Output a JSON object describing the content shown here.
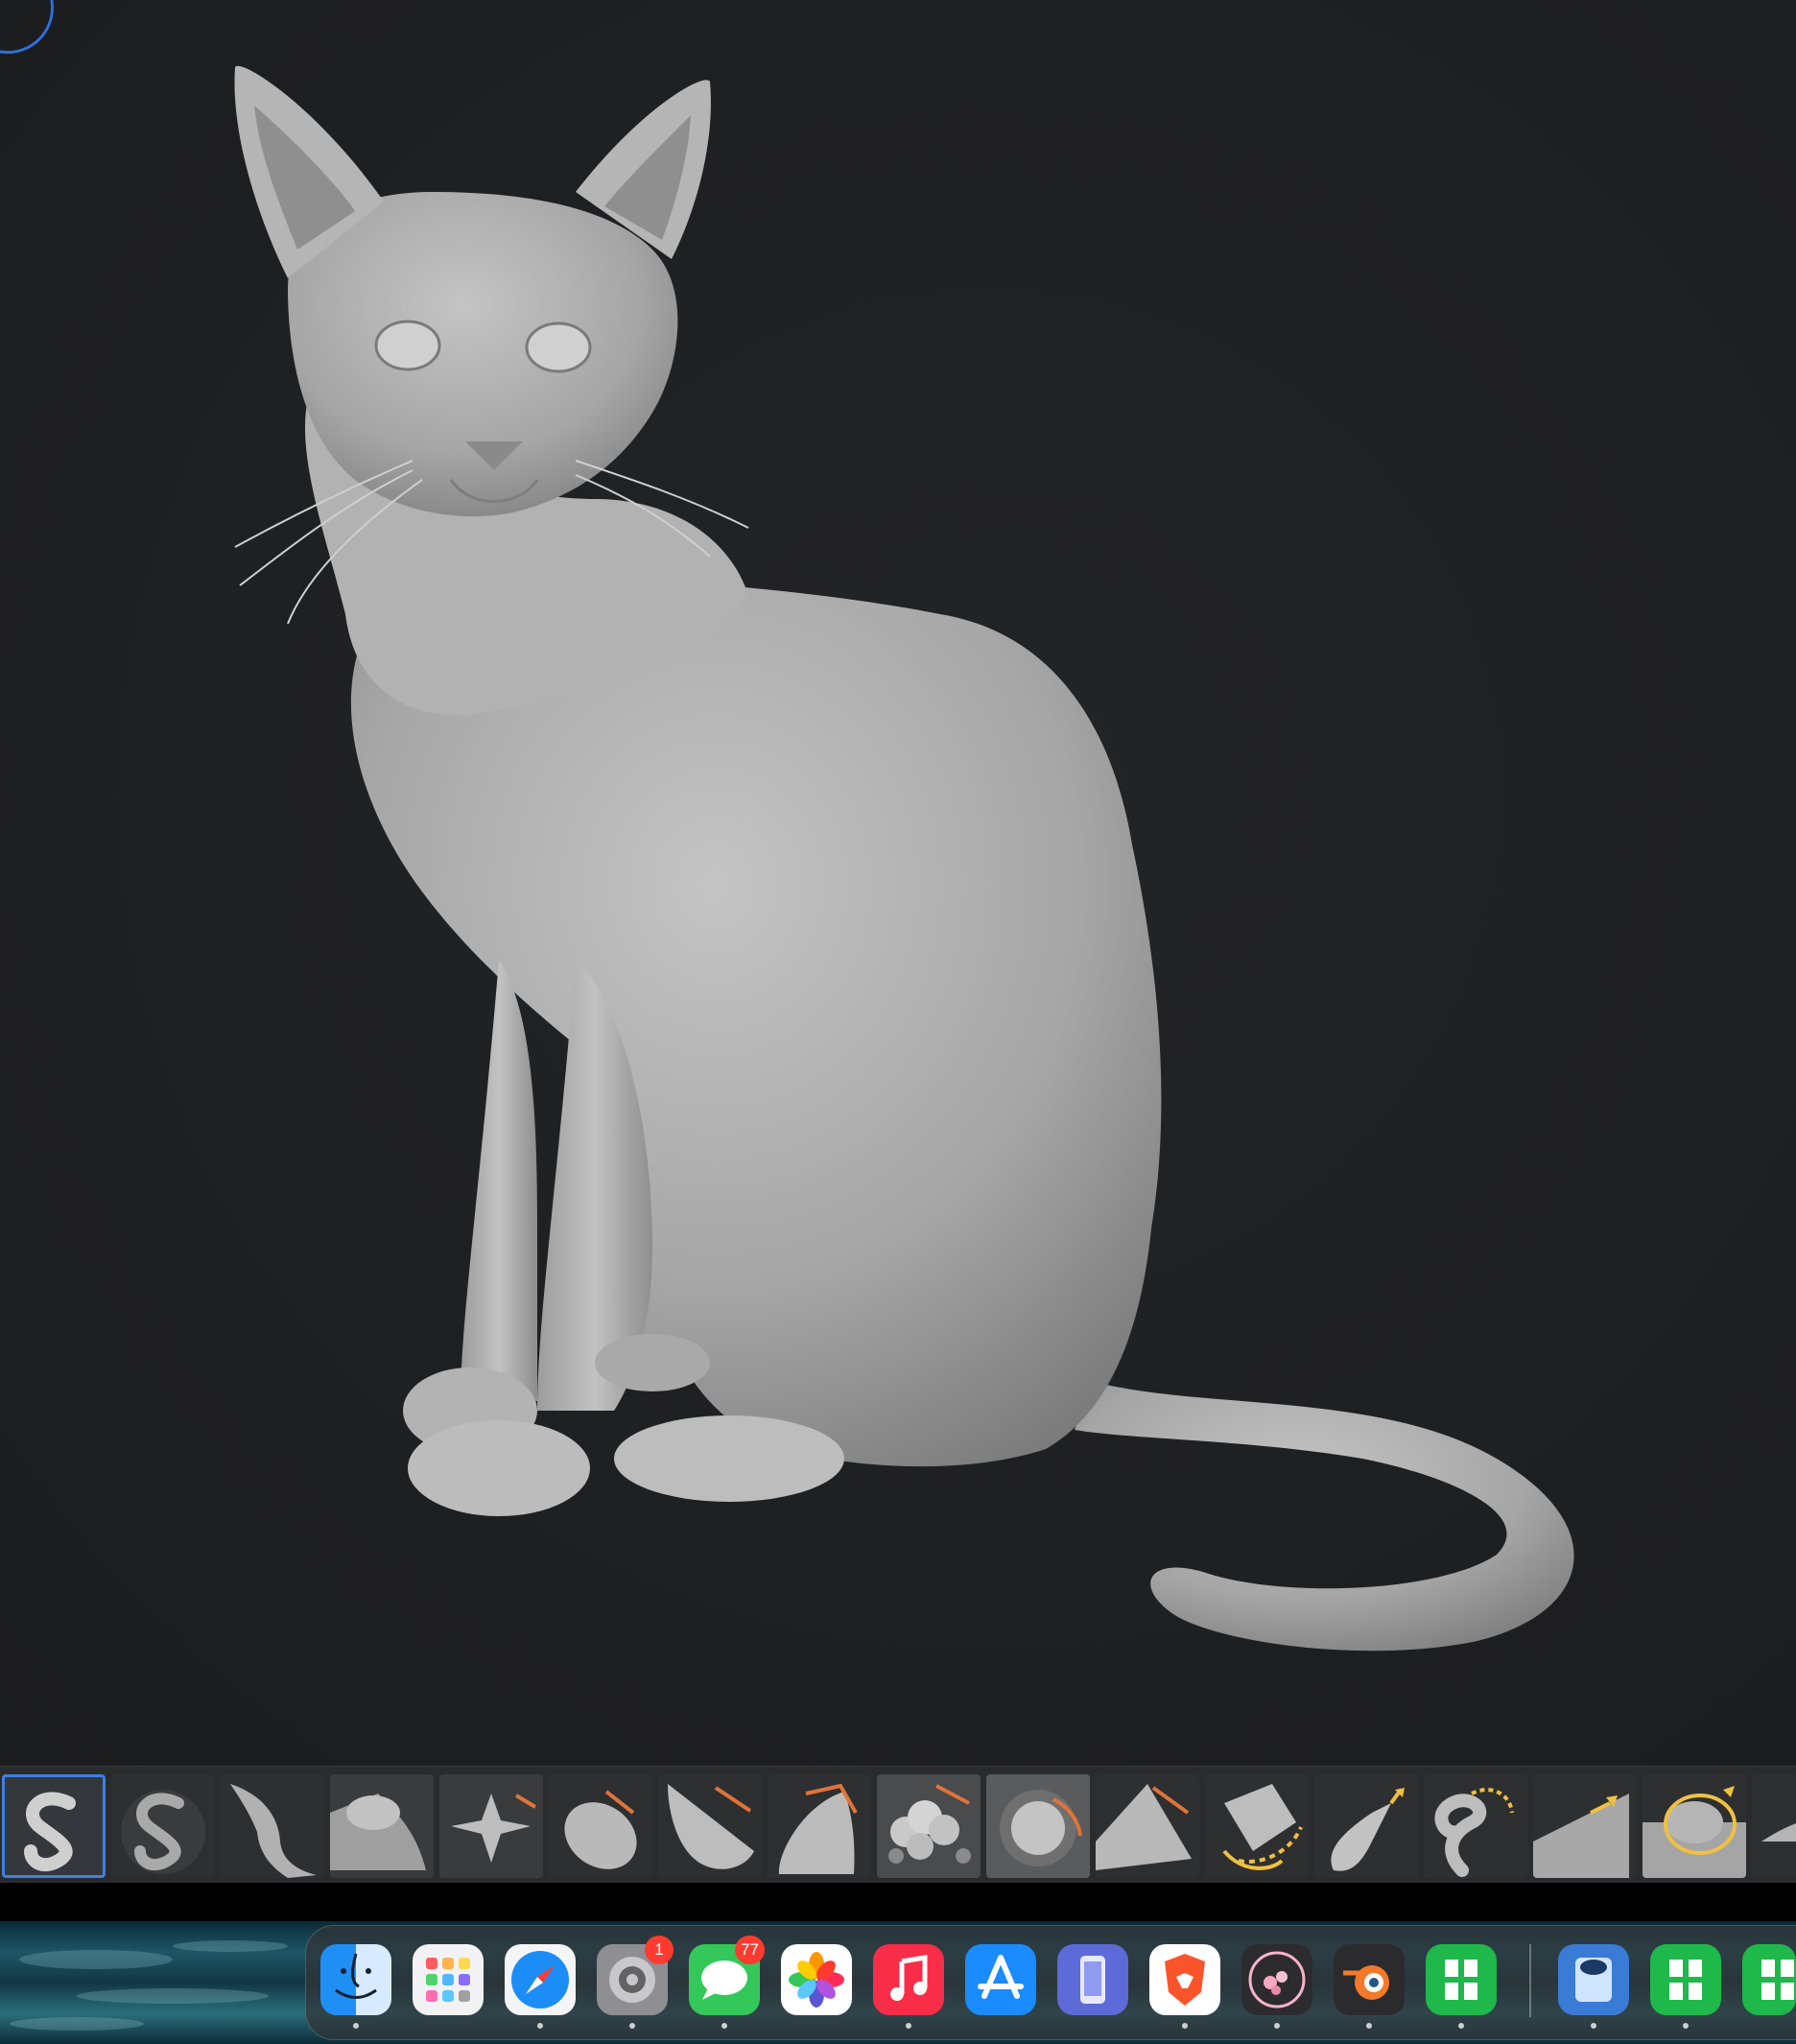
{
  "viewport": {
    "background": "#1f2022",
    "model_color": "#9a9a9a",
    "gizmo_color": "#2d6fd6"
  },
  "brush_shelf": {
    "active_index": 0,
    "brushes": [
      "standard-brush-icon",
      "clay-buildup-brush-icon",
      "move-brush-icon",
      "inflate-brush-icon",
      "pinch-brush-icon",
      "flatten-brush-icon",
      "trim-dynamic-brush-icon",
      "hpolish-brush-icon",
      "noise-brush-icon",
      "dam-standard-brush-icon",
      "planar-brush-icon",
      "snakehook-brush-icon",
      "curve-brush-icon",
      "curve-tube-brush-icon",
      "imm-brush-icon",
      "insert-mesh-brush-icon",
      "chisel-brush-icon"
    ]
  },
  "dock": {
    "apps": [
      {
        "name": "finder",
        "badge": ""
      },
      {
        "name": "launchpad",
        "badge": ""
      },
      {
        "name": "safari",
        "badge": ""
      },
      {
        "name": "system-settings",
        "badge": "1"
      },
      {
        "name": "messages",
        "badge": "77"
      },
      {
        "name": "photos",
        "badge": ""
      },
      {
        "name": "music",
        "badge": ""
      },
      {
        "name": "app-store",
        "badge": ""
      },
      {
        "name": "simulator",
        "badge": ""
      },
      {
        "name": "brave",
        "badge": ""
      },
      {
        "name": "blossom-app",
        "badge": ""
      },
      {
        "name": "blender",
        "badge": ""
      },
      {
        "name": "numbers",
        "badge": ""
      },
      {
        "name": "screen-capture",
        "badge": ""
      },
      {
        "name": "numbers-2",
        "badge": ""
      },
      {
        "name": "numbers-3",
        "badge": ""
      }
    ]
  }
}
